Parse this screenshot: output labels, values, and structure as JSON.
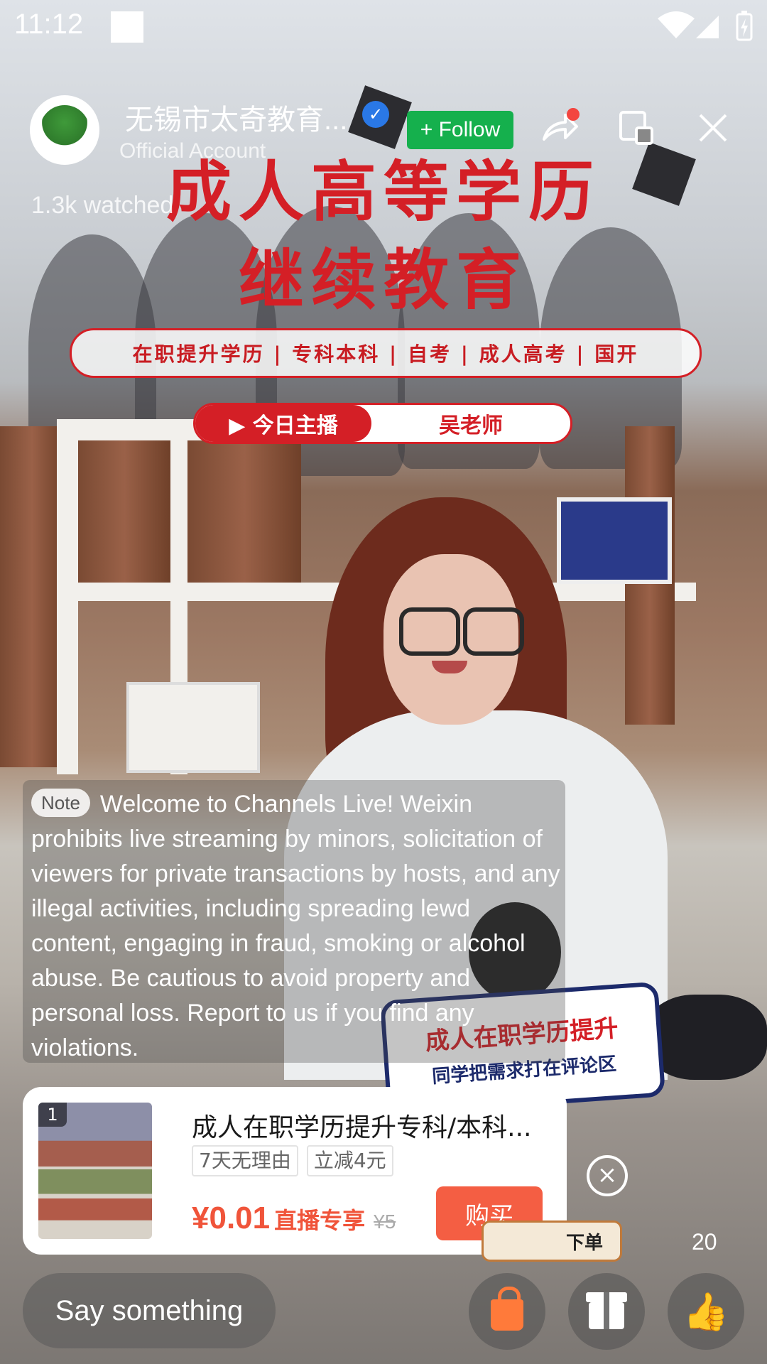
{
  "status_bar": {
    "time": "11:12"
  },
  "header": {
    "account_name": "无锡市太奇教育...",
    "account_type": "Official Account",
    "follow_label": "+ Follow",
    "watched": "1.3k watched"
  },
  "stream_overlay": {
    "title_line1": "成人高等学历",
    "title_line2": "继续教育",
    "categories": "在职提升学历 | 专科本科 | 自考 | 成人高考 | 国开",
    "host_label": "▶ 今日主播",
    "host_name": "吴老师",
    "sign_line1": "成人在职学历提升",
    "sign_line2": "同学把需求打在评论区"
  },
  "note": {
    "badge": "Note",
    "text": "Welcome to Channels Live! Weixin prohibits live streaming by minors, solicitation of viewers for private transactions by hosts, and any illegal activities, including spreading lewd content, engaging in fraud, smoking or alcohol abuse. Be cautious to avoid property and personal loss. Report to us if you find any violations."
  },
  "product": {
    "index": "1",
    "title": "成人在职学历提升专科/本科...",
    "tags": [
      "7天无理由",
      "立减4元"
    ],
    "price": "¥0.01",
    "live_price_label": "直播专享",
    "original_price": "¥5",
    "buy_label": "购买"
  },
  "order_bubble": "下单",
  "like_count": "20",
  "bottom_bar": {
    "comment_placeholder": "Say something"
  },
  "colors": {
    "follow_green": "#15b04d",
    "buy_orange": "#f45e43",
    "price_red": "#f0543a",
    "banner_red": "#d41f26"
  },
  "icons": [
    "share-icon",
    "float-window-icon",
    "close-icon",
    "verified-icon",
    "shopping-bag-icon",
    "gift-icon",
    "thumbs-up-icon",
    "wifi-icon",
    "battery-icon"
  ]
}
